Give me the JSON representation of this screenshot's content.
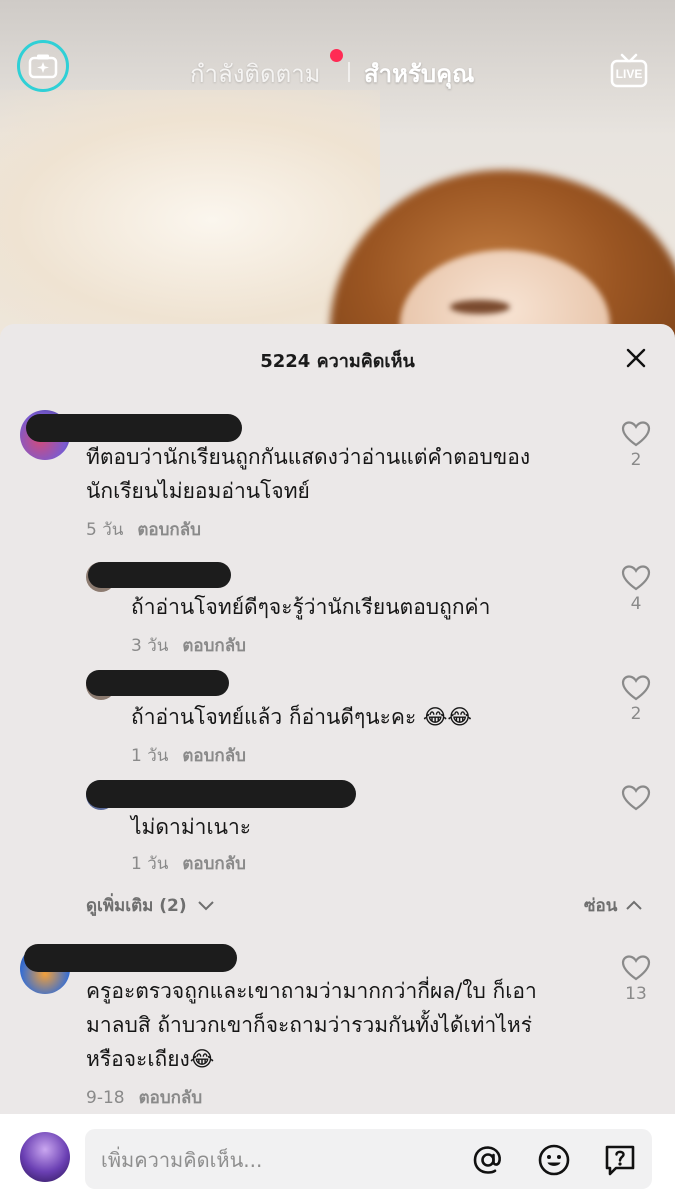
{
  "header": {
    "tabs": [
      {
        "label": "กำลังติดตาม"
      },
      {
        "label": "สำหรับคุณ"
      }
    ],
    "live_label": "LIVE",
    "accent_color": "#2fd0d6",
    "notification_dot_color": "#ff2b54"
  },
  "comments_sheet": {
    "title": "5224 ความคิดเห็น",
    "comments": [
      {
        "text_lines": [
          "ทีตอบว่านักเรียนถูกกันแสดงว่าอ่านแต่คำตอบของ",
          "นักเรียนไม่ยอมอ่านโจทย์"
        ],
        "time": "5 วัน",
        "reply": "ตอบกลับ",
        "likes": "2"
      },
      {
        "text_lines": [
          "ถ้าอ่านโจทย์ดีๆจะรู้ว่านักเรียนตอบถูกค่า"
        ],
        "time": "3 วัน",
        "reply": "ตอบกลับ",
        "likes": "4"
      },
      {
        "text_lines": [
          "ถ้าอ่านโจทย์แล้ว ก็อ่านดีๆนะคะ 😂😂"
        ],
        "time": "1 วัน",
        "reply": "ตอบกลับ",
        "likes": "2"
      },
      {
        "text_lines": [
          "ไม่ดาม่าเนาะ"
        ],
        "time": "1 วัน",
        "reply": "ตอบกลับ",
        "likes": ""
      },
      {
        "text_lines": [
          "ครูอะตรวจถูกและเขาถามว่ามากกว่ากี่ผล/ใบ ก็เอา",
          "มาลบสิ ถ้าบวกเขาก็จะถามว่ารวมกันทั้งได้เท่าไหร่",
          "หรือจะเถียง😂"
        ],
        "time": "9-18",
        "reply": "ตอบกลับ",
        "likes": "13"
      }
    ],
    "view_more": "ดูเพิ่มเติม (2)",
    "hide": "ซ่อน"
  },
  "input_bar": {
    "placeholder": "เพิ่มความคิดเห็น...",
    "icons": [
      "at-icon",
      "emoji-icon",
      "question-icon"
    ]
  }
}
